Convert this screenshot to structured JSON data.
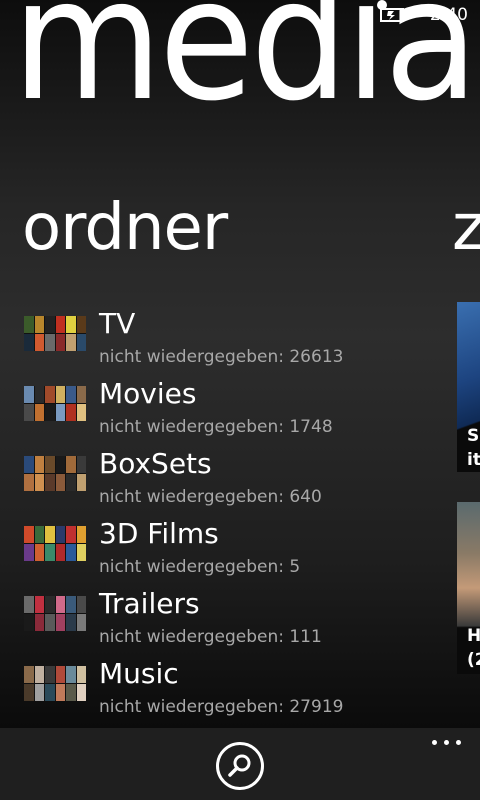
{
  "status_bar": {
    "time": "2:40",
    "icons": [
      "signal-dot-icon",
      "battery-charging-icon"
    ]
  },
  "panorama": {
    "title": "media"
  },
  "section": {
    "header": "ordner",
    "next_header_peek": "z"
  },
  "folders": [
    {
      "name": "TV",
      "sub": "nicht wiedergegeben: 26613"
    },
    {
      "name": "Movies",
      "sub": "nicht wiedergegeben: 1748"
    },
    {
      "name": "BoxSets",
      "sub": "nicht wiedergegeben: 640"
    },
    {
      "name": "3D Films",
      "sub": "nicht wiedergegeben: 5"
    },
    {
      "name": "Trailers",
      "sub": "nicht wiedergegeben: 111"
    },
    {
      "name": "Music",
      "sub": "nicht wiedergegeben: 27919"
    }
  ],
  "peek_tiles": [
    {
      "caption_lines": [
        "S",
        "it"
      ]
    },
    {
      "caption_lines": [
        "H",
        "(2"
      ]
    }
  ],
  "app_bar": {
    "icons": [
      "search-icon",
      "more-options-icon"
    ]
  },
  "colors": {
    "background": "#262626",
    "app_bar": "#1f1f1f",
    "subtext": "#a8a8a8",
    "text": "#ffffff"
  }
}
